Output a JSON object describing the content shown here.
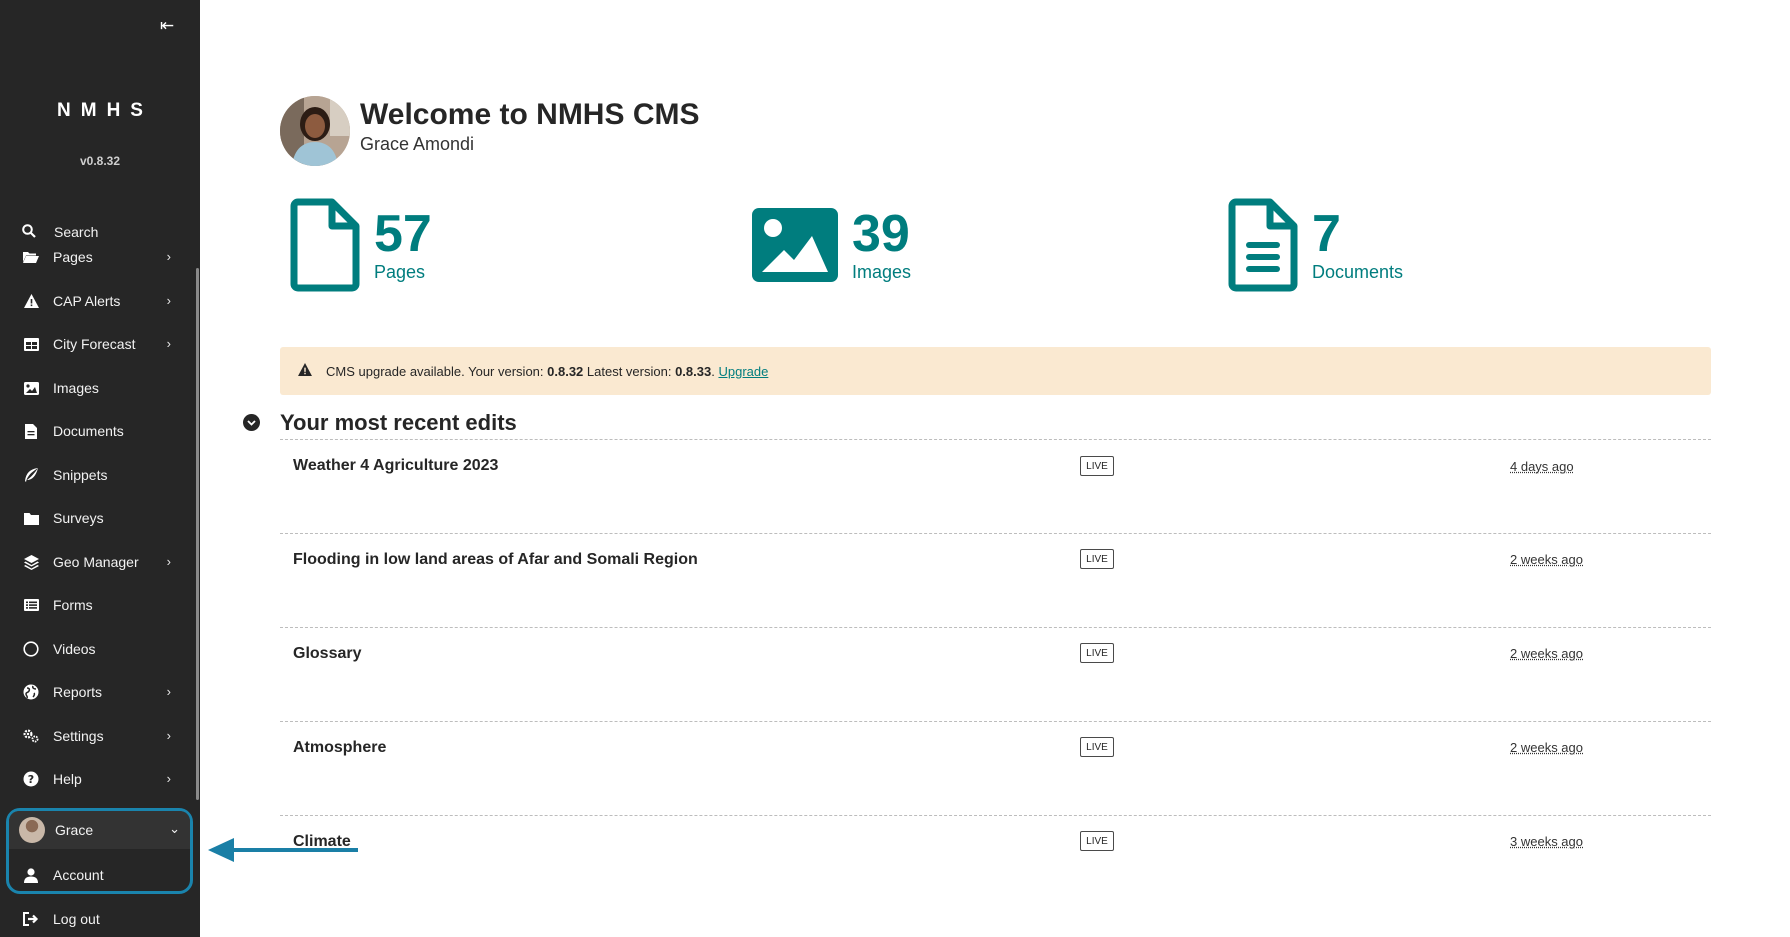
{
  "sidebar": {
    "collapse_label": "⇤",
    "logo": "NMHS",
    "version": "v0.8.32",
    "search_label": "Search",
    "items": [
      {
        "label": "Pages",
        "icon": "folder-open-icon",
        "has_children": true
      },
      {
        "label": "CAP Alerts",
        "icon": "warning-icon",
        "has_children": true
      },
      {
        "label": "City Forecast",
        "icon": "table-icon",
        "has_children": true
      },
      {
        "label": "Images",
        "icon": "image-icon",
        "has_children": false
      },
      {
        "label": "Documents",
        "icon": "document-icon",
        "has_children": false
      },
      {
        "label": "Snippets",
        "icon": "snippet-icon",
        "has_children": false
      },
      {
        "label": "Surveys",
        "icon": "folder-icon",
        "has_children": false
      },
      {
        "label": "Geo Manager",
        "icon": "layers-icon",
        "has_children": true
      },
      {
        "label": "Forms",
        "icon": "form-icon",
        "has_children": false
      },
      {
        "label": "Videos",
        "icon": "circle-icon",
        "has_children": false
      },
      {
        "label": "Reports",
        "icon": "globe-icon",
        "has_children": true
      },
      {
        "label": "Settings",
        "icon": "cogs-icon",
        "has_children": true
      },
      {
        "label": "Help",
        "icon": "help-icon",
        "has_children": true
      }
    ],
    "account_menu": {
      "user_label": "Grace",
      "account_label": "Account",
      "logout_label": "Log out"
    }
  },
  "header": {
    "title": "Welcome to NMHS CMS",
    "user_name": "Grace Amondi"
  },
  "stats": [
    {
      "count": "57",
      "label": "Pages",
      "icon": "page-icon"
    },
    {
      "count": "39",
      "label": "Images",
      "icon": "image-icon"
    },
    {
      "count": "7",
      "label": "Documents",
      "icon": "document-icon"
    }
  ],
  "upgrade": {
    "prefix": "CMS upgrade available. Your version: ",
    "current_version": "0.8.32",
    "middle": " Latest version: ",
    "latest_version": "0.8.33",
    "suffix": ". ",
    "link": "Upgrade"
  },
  "recent_edits": {
    "title": "Your most recent edits",
    "rows": [
      {
        "title": "Weather 4 Agriculture 2023",
        "status": "LIVE",
        "time": "4 days ago"
      },
      {
        "title": "Flooding in low land areas of Afar and Somali Region",
        "status": "LIVE",
        "time": "2 weeks ago"
      },
      {
        "title": "Glossary",
        "status": "LIVE",
        "time": "2 weeks ago"
      },
      {
        "title": "Atmosphere",
        "status": "LIVE",
        "time": "2 weeks ago"
      },
      {
        "title": "Climate",
        "status": "LIVE",
        "time": "3 weeks ago"
      }
    ]
  },
  "colors": {
    "sidebar_bg": "#262626",
    "accent": "#007d7e",
    "banner_bg": "#fae9d1",
    "highlight": "#1a84ad"
  }
}
